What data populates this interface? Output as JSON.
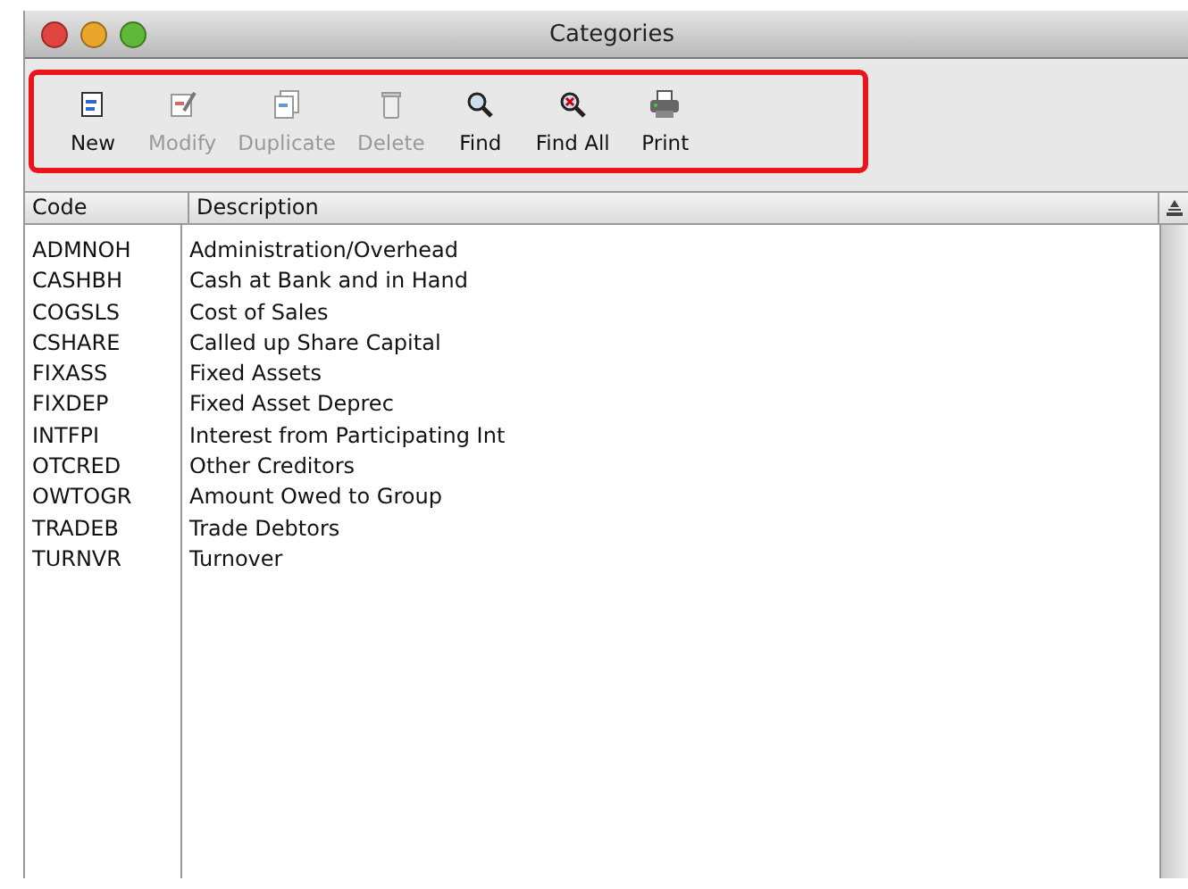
{
  "window": {
    "title": "Categories"
  },
  "toolbar": [
    {
      "label": "New",
      "disabled": false,
      "kind": "new"
    },
    {
      "label": "Modify",
      "disabled": true,
      "kind": "modify"
    },
    {
      "label": "Duplicate",
      "disabled": true,
      "kind": "duplicate"
    },
    {
      "label": "Delete",
      "disabled": true,
      "kind": "delete"
    },
    {
      "label": "Find",
      "disabled": false,
      "kind": "find"
    },
    {
      "label": "Find All",
      "disabled": false,
      "kind": "findall"
    },
    {
      "label": "Print",
      "disabled": false,
      "kind": "print"
    }
  ],
  "table": {
    "columns": [
      "Code",
      "Description"
    ],
    "rows": [
      [
        "ADMNOH",
        "Administration/Overhead"
      ],
      [
        "CASHBH",
        "Cash at Bank and in Hand"
      ],
      [
        "COGSLS",
        "Cost of Sales"
      ],
      [
        "CSHARE",
        "Called up Share Capital"
      ],
      [
        "FIXASS",
        "Fixed Assets"
      ],
      [
        "FIXDEP",
        "Fixed Asset Deprec"
      ],
      [
        "INTFPI",
        "Interest from Participating Int"
      ],
      [
        "OTCRED",
        "Other Creditors"
      ],
      [
        "OWTOGR",
        "Amount Owed to Group"
      ],
      [
        "TRADEB",
        "Trade Debtors"
      ],
      [
        "TURNVR",
        "Turnover"
      ]
    ]
  }
}
